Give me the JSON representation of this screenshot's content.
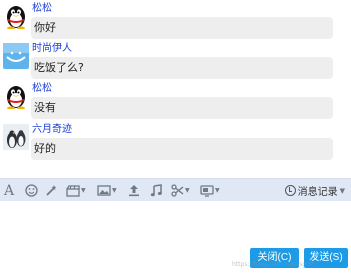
{
  "messages": [
    {
      "sender": "松松",
      "text": "你好",
      "avatar": "qq-penguin-icon"
    },
    {
      "sender": "时尚伊人",
      "text": "吃饭了么?",
      "avatar": "blue-sky-avatar"
    },
    {
      "sender": "松松",
      "text": "没有",
      "avatar": "qq-penguin-icon"
    },
    {
      "sender": "六月奇迹",
      "text": "好的",
      "avatar": "penguin-photo-avatar"
    }
  ],
  "toolbar": {
    "icons": [
      "font-icon",
      "emoji-icon",
      "magic-wand-icon",
      "film-icon",
      "image-icon",
      "upload-icon",
      "music-icon",
      "scissors-icon",
      "screen-share-icon"
    ],
    "history_label": "消息记录"
  },
  "buttons": {
    "close_label": "关闭(C)",
    "send_label": "发送(S)"
  },
  "watermark": "https://blog.csdn.net/ssg00"
}
